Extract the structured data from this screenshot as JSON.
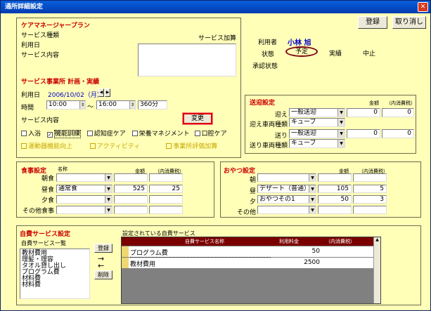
{
  "window": {
    "title": "通所詳細設定"
  },
  "toolbar": {
    "register": "登録",
    "cancel": "取り消し"
  },
  "care": {
    "title": "ケアマネージャープラン",
    "service_type": "サービス種類",
    "use_date": "利用日",
    "service_content": "サービス内容",
    "service_add": "サービス加算"
  },
  "user": {
    "label": "利用者",
    "name": "小林 旭",
    "status_label": "状態",
    "status_opts": [
      "予定",
      "実績",
      "中止"
    ],
    "approval": "承認状態"
  },
  "plan": {
    "title": "サービス事業所 計画・実績",
    "date_label": "利用日",
    "date": "2006/10/02（月）",
    "time_label": "時間",
    "start": "10:00",
    "sep": "～",
    "end": "16:00",
    "minutes": "360分",
    "content_label": "サービス内容",
    "change": "変更"
  },
  "services": {
    "row1": [
      "入浴",
      "機能訓練",
      "認知症ケア",
      "栄養マネジメント",
      "口腔ケア"
    ],
    "row1_checked": [
      false,
      true,
      false,
      false,
      false
    ],
    "row2": [
      "運動器機能向上",
      "アクティビティ",
      "事業所評価加算"
    ]
  },
  "transport": {
    "title": "送迎設定",
    "h_amount": "金額",
    "h_tax": "（内消費税）",
    "rows": [
      {
        "label": "迎え",
        "value": "一般送迎",
        "amount": "0",
        "tax": "0"
      },
      {
        "label": "迎え車両種類",
        "value": "キューブ"
      },
      {
        "label": "送り",
        "value": "一般送迎",
        "amount": "0",
        "tax": "0"
      },
      {
        "label": "送り車両種類",
        "value": "キューブ"
      }
    ]
  },
  "meal": {
    "title": "食事設定",
    "h_name": "名称",
    "h_amount": "金額",
    "h_tax": "（内消費税）",
    "rows": [
      {
        "label": "朝食",
        "value": "",
        "amount": "",
        "tax": ""
      },
      {
        "label": "昼食",
        "value": "通常食",
        "amount": "525",
        "tax": "25"
      },
      {
        "label": "夕食",
        "value": "",
        "amount": "",
        "tax": ""
      },
      {
        "label": "その他食事",
        "value": "",
        "amount": "",
        "tax": ""
      }
    ]
  },
  "snack": {
    "title": "おやつ設定",
    "h_amount": "金額",
    "h_tax": "（内消費税）",
    "rows": [
      {
        "label": "朝",
        "value": "",
        "amount": "",
        "tax": ""
      },
      {
        "label": "昼",
        "value": "デザート（普通）",
        "amount": "105",
        "tax": "5"
      },
      {
        "label": "夕",
        "value": "おやつその1",
        "amount": "50",
        "tax": "3"
      },
      {
        "label": "その他",
        "value": "",
        "amount": "",
        "tax": ""
      }
    ]
  },
  "selfpay": {
    "title": "自費サービス設定",
    "list_label": "自費サービス一覧",
    "list": [
      "教材費用",
      "理髪・理容",
      "タオル貸し出し",
      "プログラム費",
      "材料費",
      "材料費"
    ],
    "add": "登録",
    "arrow_right": "→",
    "arrow_left": "←",
    "delete": "削除",
    "set_label": "設定されている自費サービス",
    "cols": [
      "自費サービス名称",
      "利用料金",
      "（内消費税）"
    ],
    "rows": [
      {
        "name": "プログラム費",
        "fee": "50",
        "tax": ""
      },
      {
        "name": "教材費用",
        "fee": "2500",
        "tax": ""
      }
    ]
  },
  "colors": {
    "background": "#ffffb8",
    "section": "#cc0000",
    "titlebar": "#0a5fdc",
    "grid_header": "#7a0000"
  }
}
